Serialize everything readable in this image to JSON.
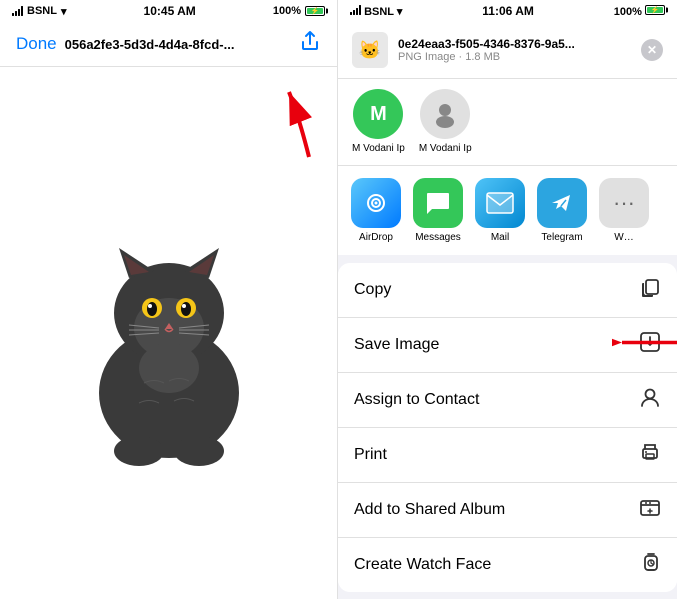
{
  "left": {
    "statusBar": {
      "carrier": "BSNL",
      "time": "10:45 AM",
      "batteryPercent": "100%"
    },
    "navBar": {
      "doneLabel": "Done",
      "fileName": "056a2fe3-5d3d-4d4a-8fcd-..."
    }
  },
  "right": {
    "statusBar": {
      "carrier": "BSNL",
      "time": "11:06 AM",
      "batteryPercent": "100%"
    },
    "shareSheet": {
      "fileTitle": "0e24eaa3-f505-4346-8376-9a5...",
      "fileType": "PNG Image · 1.8 MB",
      "contacts": [
        {
          "initial": "M",
          "name": "M Vodani Ip",
          "color": "green"
        },
        {
          "initial": "",
          "name": "M Vodani Ip",
          "whatsapp": true
        }
      ],
      "apps": [
        {
          "name": "AirDrop",
          "type": "airdrop"
        },
        {
          "name": "Messages",
          "type": "messages"
        },
        {
          "name": "Mail",
          "type": "mail"
        },
        {
          "name": "Telegram",
          "type": "telegram"
        }
      ],
      "actions": [
        {
          "label": "Copy",
          "icon": "📋"
        },
        {
          "label": "Save Image",
          "icon": "⬇",
          "hasArrow": true
        },
        {
          "label": "Assign to Contact",
          "icon": "👤"
        },
        {
          "label": "Print",
          "icon": "🖨"
        },
        {
          "label": "Add to Shared Album",
          "icon": "📁"
        },
        {
          "label": "Create Watch Face",
          "icon": "⌚"
        }
      ]
    }
  }
}
